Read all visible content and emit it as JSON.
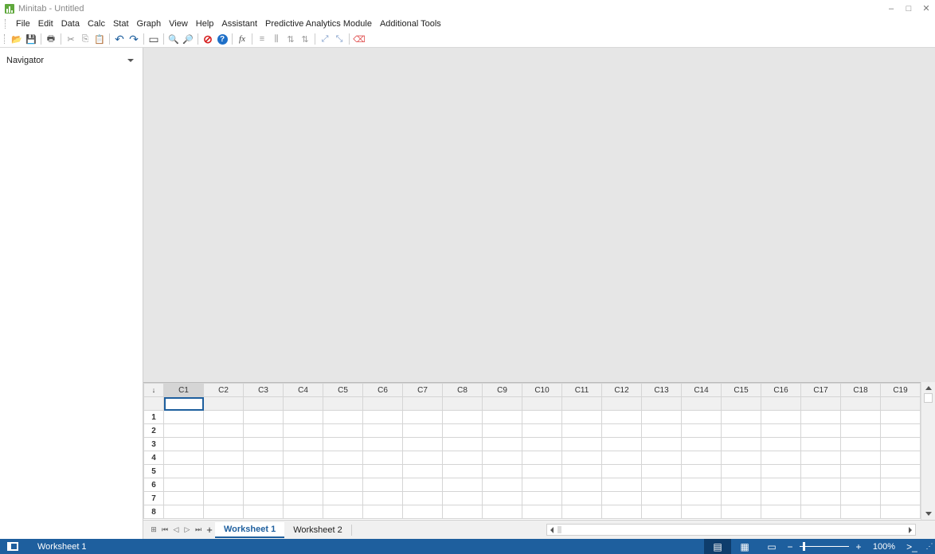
{
  "window": {
    "title": "Minitab - Untitled"
  },
  "menu": [
    "File",
    "Edit",
    "Data",
    "Calc",
    "Stat",
    "Graph",
    "View",
    "Help",
    "Assistant",
    "Predictive Analytics Module",
    "Additional Tools"
  ],
  "toolbar": [
    {
      "icon": "open-icon",
      "glyph": "📂"
    },
    {
      "icon": "save-icon",
      "glyph": "💾"
    },
    {
      "icon": "print-icon",
      "glyph": "🖶"
    },
    {
      "icon": "cut-icon",
      "glyph": "✂"
    },
    {
      "icon": "copy-icon",
      "glyph": "⎘"
    },
    {
      "icon": "paste-icon",
      "glyph": "📋"
    },
    {
      "icon": "undo-icon",
      "glyph": "↶"
    },
    {
      "icon": "redo-icon",
      "glyph": "↷"
    },
    {
      "icon": "window-icon",
      "glyph": "▭"
    },
    {
      "icon": "find-icon",
      "glyph": "🔍"
    },
    {
      "icon": "find-next-icon",
      "glyph": "🔎"
    },
    {
      "icon": "cancel-icon",
      "glyph": "⊘"
    },
    {
      "icon": "help-icon",
      "glyph": "?"
    },
    {
      "icon": "formula-icon",
      "glyph": "fx"
    },
    {
      "icon": "insert-rows-icon",
      "glyph": "≡"
    },
    {
      "icon": "insert-columns-icon",
      "glyph": "⫼"
    },
    {
      "icon": "move-columns-icon",
      "glyph": "⇅"
    },
    {
      "icon": "graph-brush-icon",
      "glyph": "⤢"
    },
    {
      "icon": "graph-edit-icon",
      "glyph": "⤡"
    },
    {
      "icon": "eraser-icon",
      "glyph": "⌫"
    }
  ],
  "navigator": {
    "title": "Navigator"
  },
  "worksheet": {
    "columns": [
      "C1",
      "C2",
      "C3",
      "C4",
      "C5",
      "C6",
      "C7",
      "C8",
      "C9",
      "C10",
      "C11",
      "C12",
      "C13",
      "C14",
      "C15",
      "C16",
      "C17",
      "C18",
      "C19"
    ],
    "rows": [
      "1",
      "2",
      "3",
      "4",
      "5",
      "6",
      "7",
      "8"
    ],
    "corner_glyph": "↓",
    "active_column": "C1"
  },
  "tabs": {
    "sheets": [
      "Worksheet 1",
      "Worksheet 2"
    ],
    "active": "Worksheet 1",
    "nav": [
      {
        "icon": "sheet-list-icon",
        "glyph": "⊞"
      },
      {
        "icon": "first-sheet-icon",
        "glyph": "⏮"
      },
      {
        "icon": "prev-sheet-icon",
        "glyph": "◁"
      },
      {
        "icon": "next-sheet-icon",
        "glyph": "▷"
      },
      {
        "icon": "last-sheet-icon",
        "glyph": "⏭"
      },
      {
        "icon": "add-sheet-icon",
        "glyph": "+"
      }
    ]
  },
  "status": {
    "sheet_name": "Worksheet 1",
    "zoom": "100%",
    "zoom_minus": "−",
    "zoom_plus": "+"
  },
  "colors": {
    "accent": "#1e5f9e",
    "output_bg": "#e6e6e6",
    "brand_green": "#5fa83c"
  }
}
